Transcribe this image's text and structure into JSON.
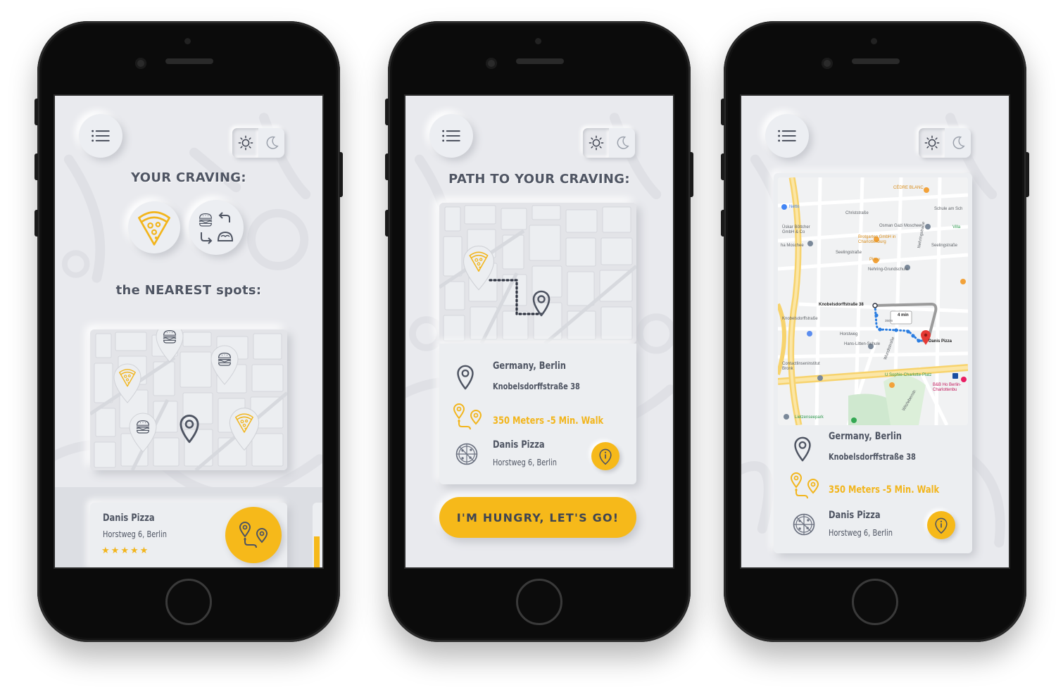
{
  "colors": {
    "accent": "#f6b91a",
    "screen_bg": "#e9eaee",
    "text": "#4f5563",
    "route_blue": "#2a7de1"
  },
  "icons": {
    "menu": "hamburger-menu-icon",
    "sun": "sun-icon",
    "moon": "moon-icon",
    "pin": "location-pin-icon",
    "route": "route-pins-icon",
    "pizza": "pizza-icon",
    "burger": "burger-icon",
    "swap": "swap-arrows-icon",
    "taco": "taco-icon",
    "info": "info-icon",
    "star": "star-icon"
  },
  "screen1": {
    "title": "YOUR  CRAVING:",
    "nearest_title": "the NEAREST spots:",
    "spot": {
      "name": "Danis Pizza",
      "address": "Horstweg 6, Berlin",
      "rating": 5
    }
  },
  "screen2": {
    "title": "PATH TO YOUR CRAVING:",
    "location_line1": "Germany, Berlin",
    "location_line2": "Knobelsdorffstraße 38",
    "distance": "350 Meters -5 Min. Walk",
    "spot_name": "Danis Pizza",
    "spot_address": "Horstweg 6, Berlin",
    "cta": "I'M HUNGRY, LET'S GO!"
  },
  "screen3": {
    "location_line1": "Germany, Berlin",
    "location_line2": "Knobelsdorffstraße 38",
    "distance": "350 Meters -5 Min. Walk",
    "spot_name": "Danis Pizza",
    "spot_address": "Horstweg 6, Berlin",
    "map": {
      "labels": [
        "CÉDRE BLANC",
        "Netto",
        "Christstraße",
        "Schule am Sch",
        "Üskar Böttcher GmbH & Co",
        "Osman Gazi Moschee",
        "Villa",
        "Brotgarten GmbH in Charlottenburg",
        "ha Moschee",
        "Seelingstraße",
        "Nehringstraße",
        "Seelingstraße",
        "Pinoy",
        "Nehring-Grundschule",
        "Knobelsdorffstraße 38",
        "Knobelsdorffstraße",
        "Horstweg",
        "Hans-Litten-Schule",
        "Danis Pizza",
        "Contactlinseninstitut Bronk",
        "U Sophie-Charlotte-Platz",
        "B&B Ho Berlin-Charlottenbu",
        "Lietzenseepark",
        "Wundtstraße",
        "Witzlebenstr."
      ],
      "walk_time": "4 min",
      "walk_dist": "350m"
    }
  }
}
